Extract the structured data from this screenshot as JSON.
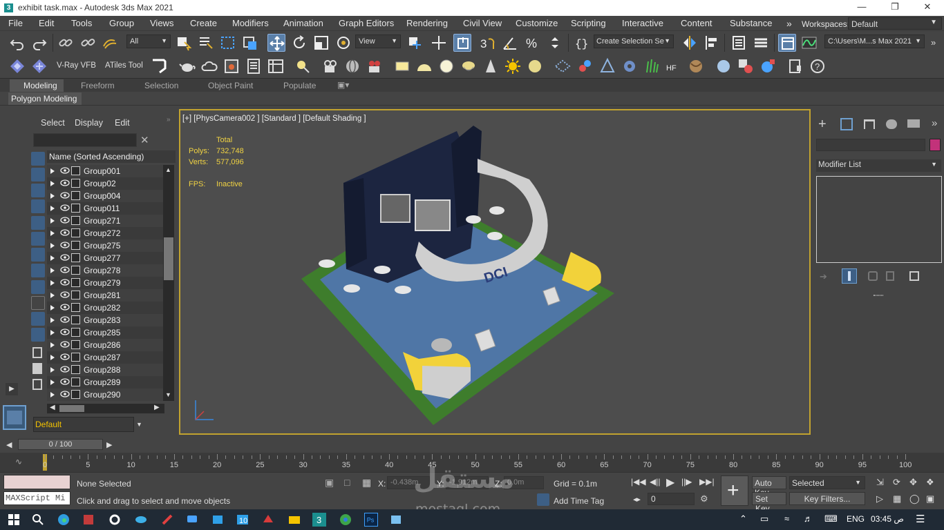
{
  "window": {
    "title": "exhibit task.max - Autodesk 3ds Max 2021",
    "app_icon": "3"
  },
  "menu": [
    "File",
    "Edit",
    "Tools",
    "Group",
    "Views",
    "Create",
    "Modifiers",
    "Animation",
    "Graph Editors",
    "Rendering",
    "Civil View",
    "Customize",
    "Scripting",
    "Interactive",
    "Content",
    "Substance"
  ],
  "workspaces": {
    "label": "Workspaces:",
    "value": "Default"
  },
  "toolbar1": {
    "selection_filter": "All",
    "ref_coord": "View",
    "named_selection": "Create Selection Se",
    "project_path": "C:\\Users\\M...s Max 2021"
  },
  "toolbar2": {
    "vray_vfb": "V-Ray VFB",
    "atiles": "ATiles Tool"
  },
  "ribbon": {
    "tabs": [
      "Modeling",
      "Freeform",
      "Selection",
      "Object Paint",
      "Populate"
    ],
    "active": "Modeling",
    "panel": "Polygon Modeling"
  },
  "scene_explorer": {
    "tabs": [
      "Select",
      "Display",
      "Edit"
    ],
    "column": "Name (Sorted Ascending)",
    "items": [
      "Group001",
      "Group02",
      "Group004",
      "Group011",
      "Group271",
      "Group272",
      "Group275",
      "Group277",
      "Group278",
      "Group279",
      "Group281",
      "Group282",
      "Group283",
      "Group285",
      "Group286",
      "Group287",
      "Group288",
      "Group289",
      "Group290"
    ],
    "layer": "Default"
  },
  "viewport": {
    "label": "[+] [PhysCamera002 ] [Standard ] [Default Shading ]",
    "stats_header": "Total",
    "polys_label": "Polys:",
    "polys": "732,748",
    "verts_label": "Verts:",
    "verts": "577,096",
    "fps_label": "FPS:",
    "fps": "Inactive",
    "logo_text": "DCI",
    "colors": {
      "floor": "#4f76a6",
      "grass": "#3e7d2c",
      "wall": "#1c2540",
      "curve": "#cfcfcf",
      "counter": "#f2d23a"
    }
  },
  "command_panel": {
    "modifier_list": "Modifier List",
    "color_swatch": "#c2327a"
  },
  "timeline": {
    "frame": "0 / 100",
    "ticks": [
      "0",
      "5",
      "10",
      "15",
      "20",
      "25",
      "30",
      "35",
      "40",
      "45",
      "50",
      "55",
      "60",
      "65",
      "70",
      "75",
      "80",
      "85",
      "90",
      "95",
      "100"
    ]
  },
  "status": {
    "selection": "None Selected",
    "prompt": "Click and drag to select and move objects",
    "maxscript": "MAXScript Mi",
    "x_label": "X:",
    "x": "-0.438m",
    "y_label": "Y:",
    "y": "-1.912m",
    "z_label": "Z:",
    "z": "0.0m",
    "grid": "Grid = 0.1m",
    "add_time_tag": "Add Time Tag",
    "auto_key": "Auto Key",
    "set_key": "Set Key",
    "key_mode": "Selected",
    "key_filters": "Key Filters...",
    "frame_field": "0"
  },
  "watermark": {
    "arabic": "مستقل",
    "latin": "mostaql.com"
  },
  "taskbar": {
    "language": "ENG",
    "time": "03:45 ص"
  }
}
